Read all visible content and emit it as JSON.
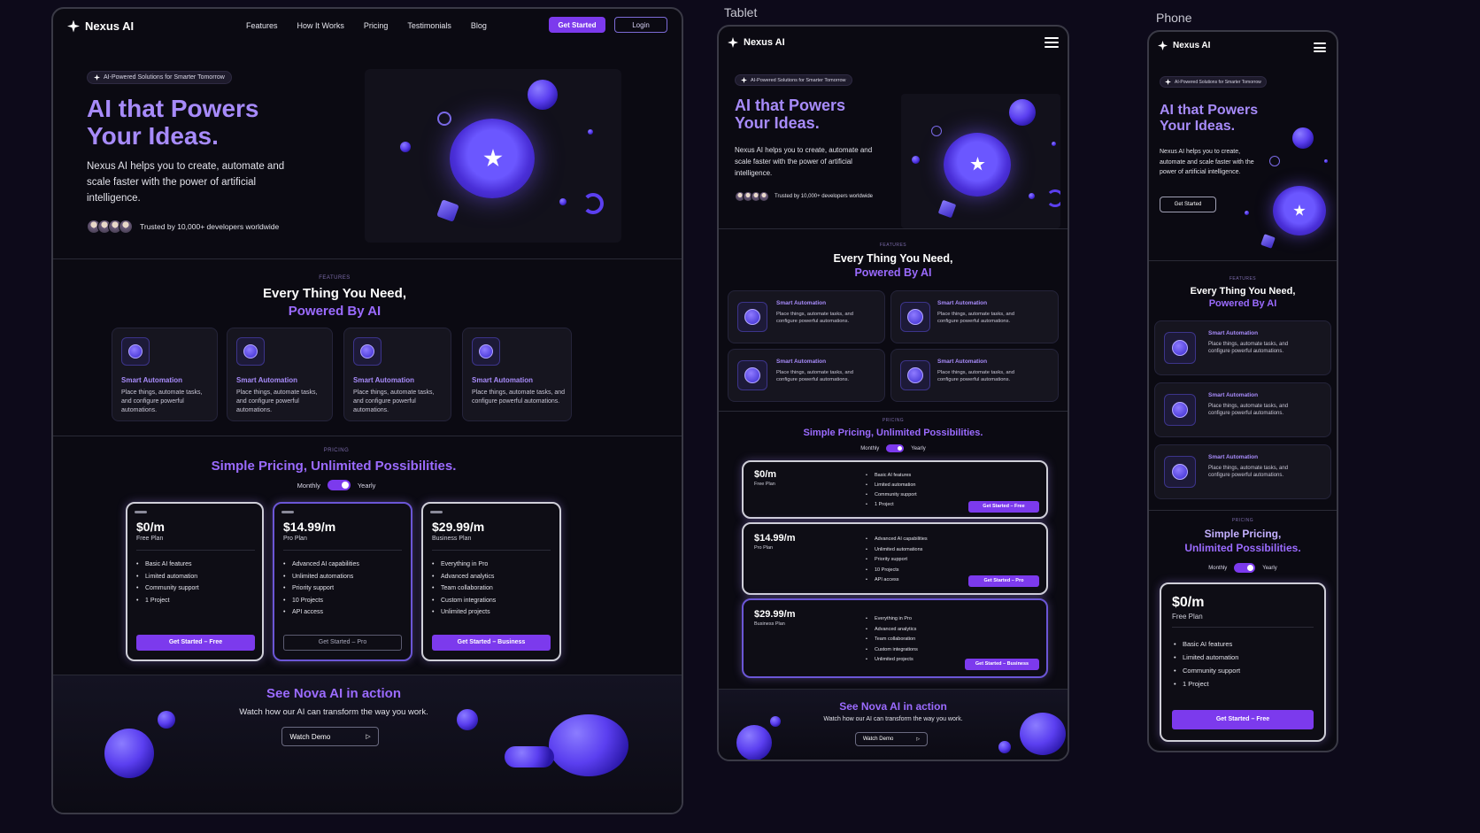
{
  "device_labels": {
    "tablet": "Tablet",
    "phone": "Phone"
  },
  "brand": "Nexus AI",
  "nav": {
    "items": [
      "Features",
      "How It Works",
      "Pricing",
      "Testimonials",
      "Blog"
    ],
    "cta": "Get Started",
    "login": "Login"
  },
  "hero": {
    "badge": "AI-Powered Solutions for Smarter Tomorrow",
    "title_line1": "AI that Powers",
    "title_line2": "Your Ideas.",
    "subtitle": "Nexus AI helps you to create, automate and scale faster with the power of artificial intelligence.",
    "trusted": "Trusted by 10,000+ developers worldwide",
    "cta": "Get Started"
  },
  "features": {
    "tag": "FEATURES",
    "title_line1": "Every Thing You Need,",
    "title_line2": "Powered By AI",
    "card_title": "Smart Automation",
    "card_desc": "Place things, automate tasks, and configure powerful automations."
  },
  "pricing": {
    "tag": "PRICING",
    "title": "Simple Pricing, Unlimited Possibilities.",
    "title_line1": "Simple Pricing,",
    "title_line2": "Unlimited Possibilities.",
    "monthly": "Monthly",
    "yearly": "Yearly",
    "plans": [
      {
        "price": "$0/m",
        "name": "Free Plan",
        "features": [
          "Basic AI features",
          "Limited automation",
          "Community support",
          "1 Project"
        ],
        "cta": "Get Started – Free"
      },
      {
        "price": "$14.99/m",
        "name": "Pro Plan",
        "features": [
          "Advanced AI capabilities",
          "Unlimited automations",
          "Priority support",
          "10 Projects",
          "API access"
        ],
        "cta": "Get Started – Pro"
      },
      {
        "price": "$29.99/m",
        "name": "Business Plan",
        "features": [
          "Everything in Pro",
          "Advanced analytics",
          "Team collaboration",
          "Custom integrations",
          "Unlimited projects"
        ],
        "cta": "Get Started – Business"
      }
    ]
  },
  "demo": {
    "title": "See Nova AI in action",
    "subtitle": "Watch how our AI can transform the way you work.",
    "button": "Watch Demo"
  },
  "colors": {
    "accent": "#7c3aed",
    "accent_light": "#a78bfa",
    "background": "#0b0a12"
  }
}
